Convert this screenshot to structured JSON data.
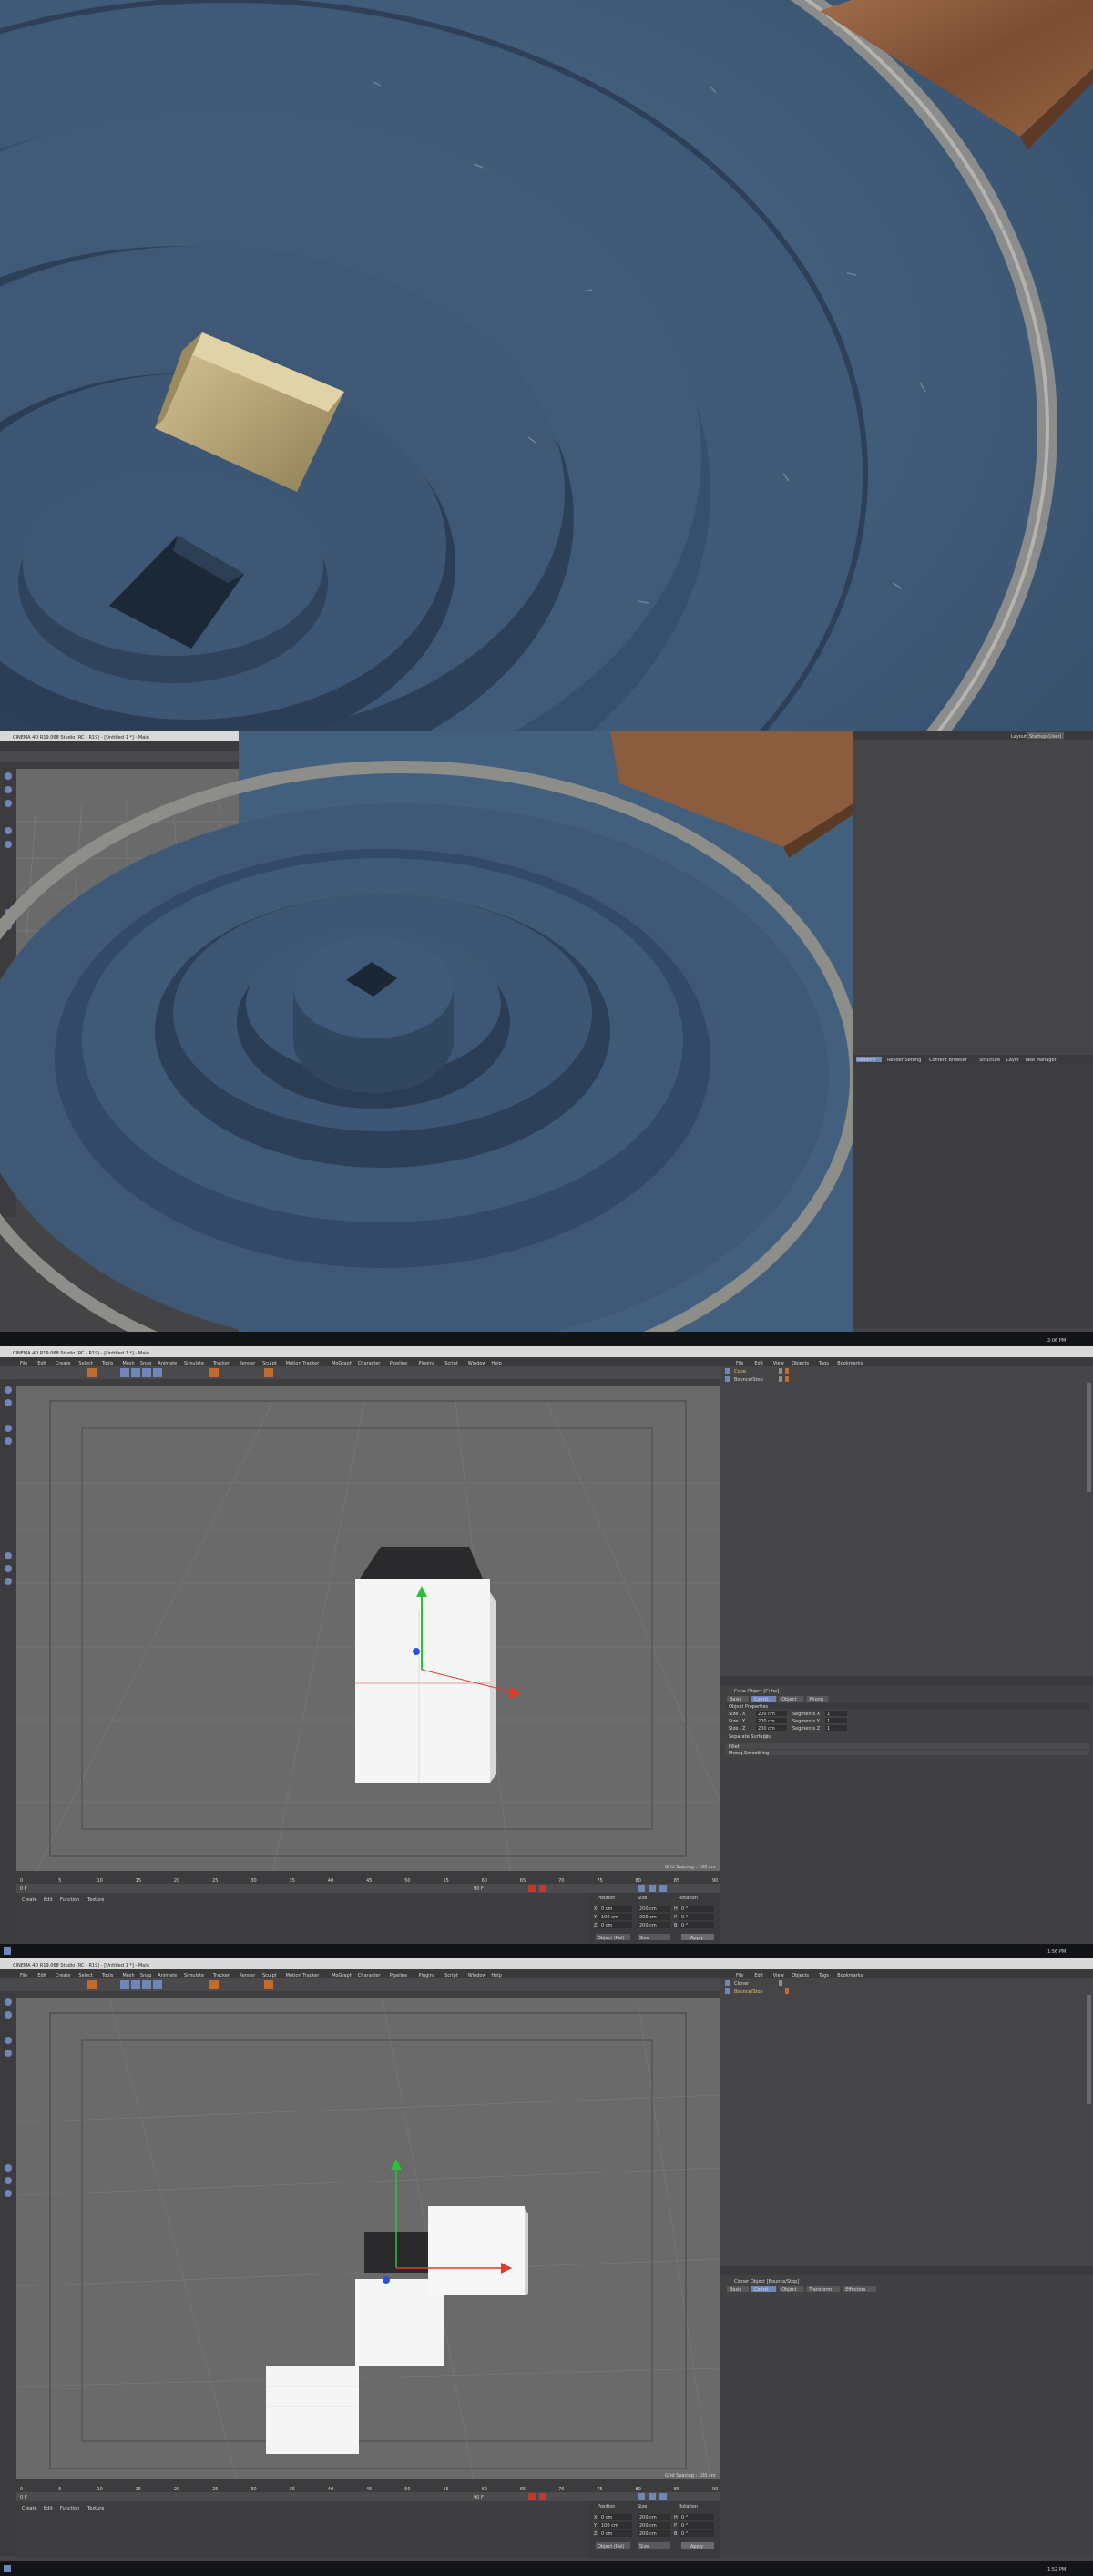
{
  "colors": {
    "c4d_bg": "#444446",
    "c4d_menu": "#3a3a3c",
    "viewport_grey": "#5f5f5f",
    "scene_blue": "#3d5672",
    "scene_blue_dark": "#2a3c52",
    "wood": "#8a5a3e",
    "gold_cube": "#b9a77a",
    "taskbar": "#121418",
    "axis_red": "#e23a2a",
    "axis_green": "#2fbf3a",
    "axis_blue": "#2a50d8",
    "accent_blue": "#6f86b8"
  },
  "windows": [
    {
      "title": "CINEMA 4D R19.068 Studio (RC - R19) - [Untitled 1 *] - Main",
      "menu": [
        "File",
        "Edit",
        "Create",
        "Select",
        "Tools",
        "Mesh",
        "Snap",
        "Animate",
        "Simulate",
        "Tracker",
        "Render",
        "Sculpt",
        "Motion Tracker",
        "MoGraph",
        "Character",
        "Pipeline",
        "Plugins",
        "Script",
        "Window",
        "Help"
      ],
      "objects_menu": [
        "File",
        "Edit",
        "View",
        "Objects",
        "Tags",
        "Bookmarks"
      ],
      "material_menu": [
        "Create",
        "Edit",
        "Function",
        "Texture"
      ],
      "timeline_ticks": [
        "0",
        "5",
        "10",
        "15",
        "20",
        "25",
        "30",
        "35",
        "40",
        "45",
        "50",
        "55",
        "60",
        "65",
        "70",
        "75",
        "80",
        "85",
        "90"
      ],
      "frame_start": "0 F",
      "frame_end": "90 F",
      "grid_spacing": "Grid Spacing : 100 cm",
      "coord_headers": [
        "Position",
        "Size",
        "Rotation"
      ],
      "coord_rows": [
        {
          "axis": "X",
          "pos": "0 cm",
          "size": "200 cm",
          "rot_label": "H",
          "rot": "0 °"
        },
        {
          "axis": "Y",
          "pos": "100 cm",
          "size": "200 cm",
          "rot_label": "P",
          "rot": "0 °"
        },
        {
          "axis": "Z",
          "pos": "0 cm",
          "size": "200 cm",
          "rot_label": "B",
          "rot": "0 °"
        }
      ],
      "coord_footer": [
        "Object (Rel)",
        "Size",
        "Apply"
      ]
    }
  ],
  "screen2": {
    "objects_title": "Layout:",
    "layout_value": "Startup (User)",
    "attr_tabs": [
      "Redshift",
      "Render Setting",
      "Content Browser",
      "Structure",
      "Layer",
      "Take Manager"
    ],
    "clock": "2:06 PM"
  },
  "screen3": {
    "objects": [
      {
        "name": "Cube"
      },
      {
        "name": "Bounce/Stop"
      }
    ],
    "attr_title": "Cube Object [Cube]",
    "attr_tabs": [
      "Basic",
      "Coord.",
      "Object",
      "Phong"
    ],
    "attr_section": "Object Properties",
    "attr_rows": [
      {
        "label": "Size . X",
        "value": "200 cm",
        "seg_label": "Segments X",
        "seg": "1"
      },
      {
        "label": "Size . Y",
        "value": "200 cm",
        "seg_label": "Segments Y",
        "seg": "1"
      },
      {
        "label": "Size . Z",
        "value": "200 cm",
        "seg_label": "Segments Z",
        "seg": "1"
      }
    ],
    "attr_check": "Separate Surfaces",
    "attr_extra": [
      "Fillet",
      "Phong Smoothing"
    ],
    "clock": "1:56 PM"
  },
  "screen4": {
    "objects": [
      {
        "name": "Cloner"
      },
      {
        "name": "Bounce/Stop"
      }
    ],
    "attr_title": "Cloner Object [Bounce/Stop]",
    "attr_tabs": [
      "Basic",
      "Coord.",
      "Object",
      "Transform",
      "Effectors"
    ],
    "clock": "1:52 PM"
  }
}
